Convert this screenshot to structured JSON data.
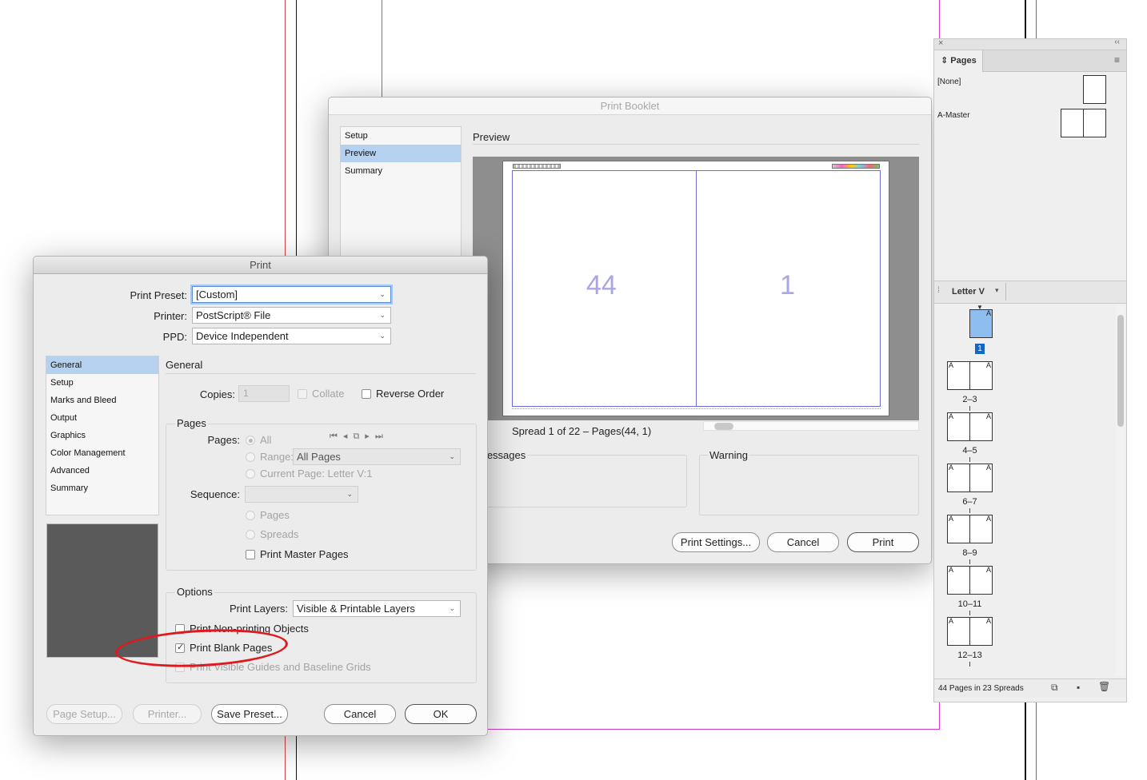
{
  "background": {
    "guide_magenta": "#d23ad2",
    "guide_red": "#d0454a",
    "guide_black": "#111111"
  },
  "booklet": {
    "title": "Print Booklet",
    "nav": [
      {
        "label": "Setup",
        "selected": false
      },
      {
        "label": "Preview",
        "selected": true
      },
      {
        "label": "Summary",
        "selected": false
      }
    ],
    "section_title": "Preview",
    "left_page": "44",
    "right_page": "1",
    "spread_info": "Spread 1 of 22 – Pages(44, 1)",
    "messages_label": "Messages",
    "warning_label": "Warning",
    "buttons": {
      "print_settings": "Print Settings...",
      "cancel": "Cancel",
      "print": "Print"
    }
  },
  "print": {
    "title": "Print",
    "preset_label": "Print Preset:",
    "preset_value": "[Custom]",
    "printer_label": "Printer:",
    "printer_value": "PostScript® File",
    "ppd_label": "PPD:",
    "ppd_value": "Device Independent",
    "nav": [
      {
        "label": "General",
        "selected": true
      },
      {
        "label": "Setup",
        "selected": false
      },
      {
        "label": "Marks and Bleed",
        "selected": false
      },
      {
        "label": "Output",
        "selected": false
      },
      {
        "label": "Graphics",
        "selected": false
      },
      {
        "label": "Color Management",
        "selected": false
      },
      {
        "label": "Advanced",
        "selected": false
      },
      {
        "label": "Summary",
        "selected": false
      }
    ],
    "section_title": "General",
    "copies_label": "Copies:",
    "copies_value": "1",
    "collate_label": "Collate",
    "reverse_label": "Reverse Order",
    "pages_group": "Pages",
    "pages_label": "Pages:",
    "all_label": "All",
    "range_label": "Range:",
    "range_value": "All Pages",
    "current_page_label": "Current Page: Letter V:1",
    "sequence_label": "Sequence:",
    "pages_option": "Pages",
    "spreads_option": "Spreads",
    "master_pages_label": "Print Master Pages",
    "options_group": "Options",
    "layers_label": "Print Layers:",
    "layers_value": "Visible & Printable Layers",
    "nonprinting_label": "Print Non-printing Objects",
    "blank_pages_label": "Print Blank Pages",
    "blank_pages_checked": true,
    "guides_label": "Print Visible Guides and Baseline Grids",
    "buttons": {
      "page_setup": "Page Setup...",
      "printer": "Printer...",
      "save_preset": "Save Preset...",
      "cancel": "Cancel",
      "ok": "OK"
    },
    "highlight_color": "#e0191f"
  },
  "pages_panel": {
    "tab_label": "Pages",
    "none_label": "[None]",
    "master_label": "A-Master",
    "section_label": "Letter V",
    "first_page_number": "1",
    "master_letter": "A",
    "spreads": [
      "2–3",
      "4–5",
      "6–7",
      "8–9",
      "10–11",
      "12–13"
    ],
    "status": "44 Pages in 23 Spreads",
    "selection_color": "#8ebdf0"
  }
}
